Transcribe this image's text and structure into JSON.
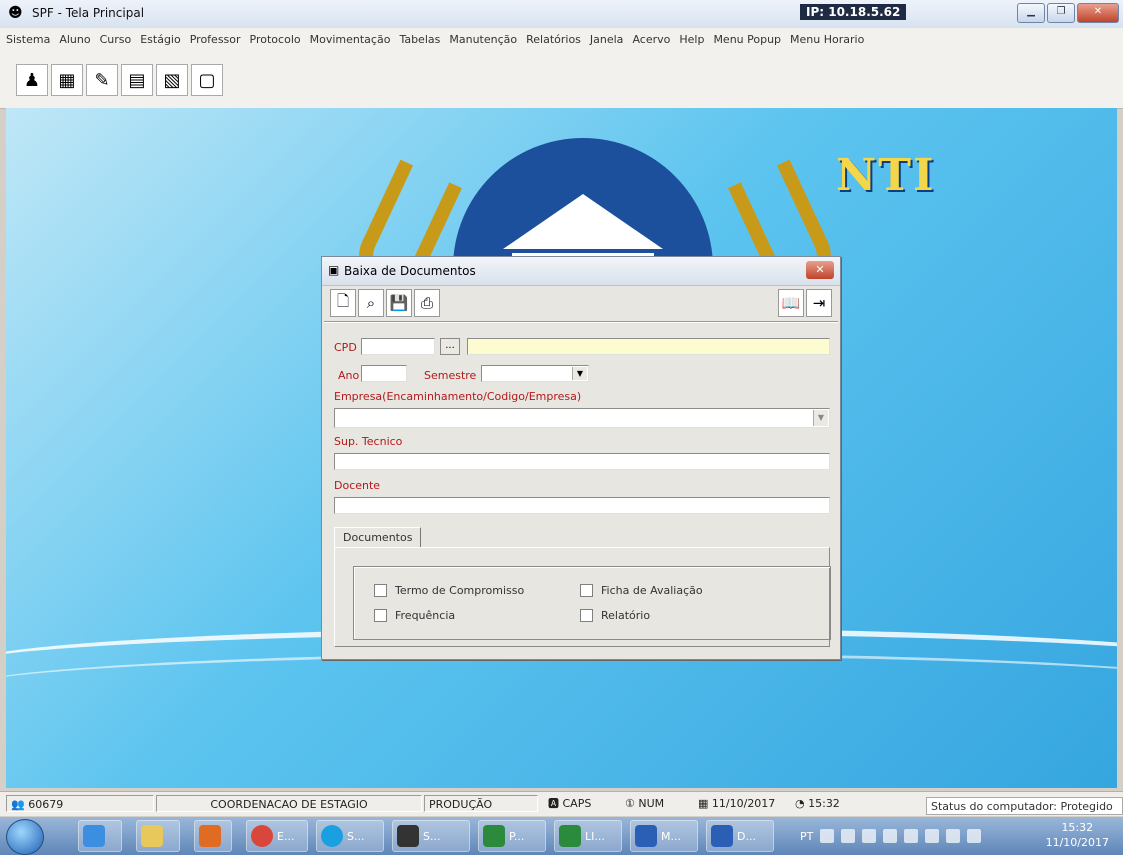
{
  "window": {
    "title": "SPF - Tela Principal",
    "ip_label": "IP: 10.18.5.62",
    "buttons": [
      "minimize",
      "restore",
      "close"
    ]
  },
  "menu": [
    "Sistema",
    "Aluno",
    "Curso",
    "Estágio",
    "Professor",
    "Protocolo",
    "Movimentação",
    "Tabelas",
    "Manutenção",
    "Relatórios",
    "Janela",
    "Acervo",
    "Help",
    "Menu Popup",
    "Menu Horario"
  ],
  "toolbar": {
    "icons": [
      "student-icon",
      "grid-icon",
      "search-doc-icon",
      "calendar-icon",
      "report-icon",
      "window-icon"
    ]
  },
  "background": {
    "logo_text": "NTI"
  },
  "dialog": {
    "title": "Baixa de Documentos",
    "toolbar_left": [
      "new-document-icon",
      "search-icon",
      "save-icon",
      "print-icon"
    ],
    "toolbar_right": [
      "help-book-icon",
      "exit-icon"
    ],
    "fields": {
      "cpd_label": "CPD",
      "cpd_value": "",
      "lookup_button": "...",
      "name_value": "",
      "ano_label": "Ano",
      "ano_value": "",
      "semestre_label": "Semestre",
      "semestre_value": "",
      "empresa_label": "Empresa(Encaminhamento/Codigo/Empresa)",
      "empresa_value": "",
      "sup_tecnico_label": "Sup. Tecnico",
      "sup_tecnico_value": "",
      "docente_label": "Docente",
      "docente_value": ""
    },
    "tab_label": "Documentos",
    "checkboxes": [
      {
        "label": "Termo de Compromisso",
        "checked": false
      },
      {
        "label": "Ficha de Avaliação",
        "checked": false
      },
      {
        "label": "Frequência",
        "checked": false
      },
      {
        "label": "Relatório",
        "checked": false
      }
    ]
  },
  "statusbar": {
    "user_code": "60679",
    "department": "COORDENACAO DE ESTAGIO",
    "environment": "PRODUÇÃO",
    "caps": "CAPS",
    "num": "NUM",
    "date": "11/10/2017",
    "time": "15:32",
    "protected_status": "Status do computador: Protegido"
  },
  "taskbar": {
    "apps": [
      {
        "label": "E..."
      },
      {
        "label": "S..."
      },
      {
        "label": "S..."
      },
      {
        "label": "P..."
      },
      {
        "label": "LI..."
      },
      {
        "label": "M..."
      },
      {
        "label": "D..."
      }
    ],
    "language": "PT",
    "clock_time": "15:32",
    "clock_date": "11/10/2017"
  },
  "colors": {
    "label_red": "#b21a1a",
    "logo_blue": "#1c4f9c",
    "laurel_gold": "#c79b19",
    "desktop_blue": "#36a6e0"
  }
}
